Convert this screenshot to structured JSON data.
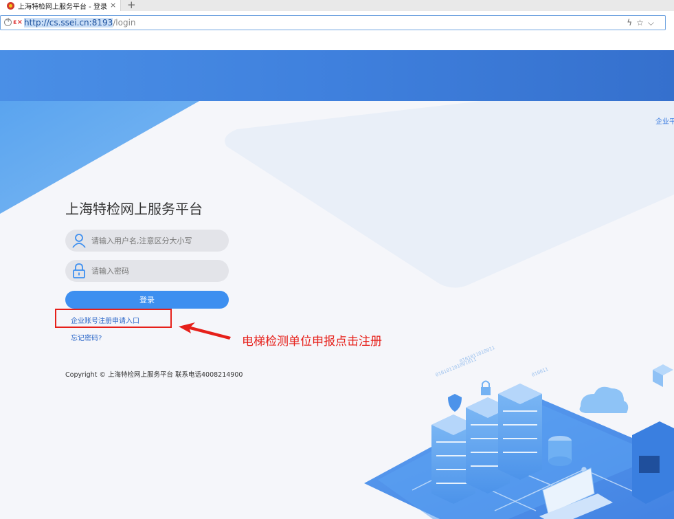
{
  "browser": {
    "tab_title": "上海特检网上服务平台 - 登录",
    "tab_close": "×",
    "new_tab": "+",
    "url_highlight": "http://cs.ssei.cn:8193",
    "url_rest": "/login"
  },
  "header": {
    "enterprise_link": "企业平"
  },
  "login": {
    "title": "上海特检网上服务平台",
    "username_placeholder": "请输入用户名,注意区分大小写",
    "password_placeholder": "请输入密码",
    "login_button": "登录",
    "register_link": "企业账号注册申请入口",
    "forgot_link": "忘记密码?"
  },
  "annotation": {
    "text": "电梯检测单位申报点击注册",
    "color": "#e6201a"
  },
  "footer": {
    "copyright": "Copyright © 上海特检网上服务平台 联系电话4008214900"
  },
  "colors": {
    "brand_blue": "#3d8ff0",
    "banner_blue": "#4a8fe6",
    "link_blue": "#2a66c8"
  }
}
